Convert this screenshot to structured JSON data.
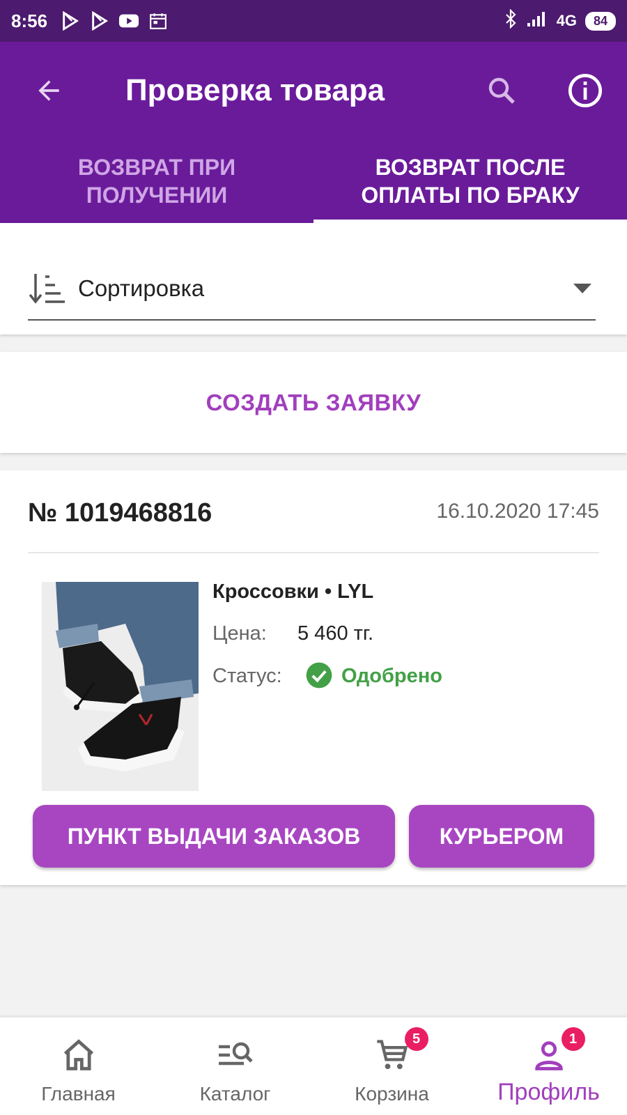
{
  "status_bar": {
    "time": "8:56",
    "network": "4G",
    "battery": "84"
  },
  "app_bar": {
    "title": "Проверка товара"
  },
  "tabs": [
    {
      "label": "Возврат при получении",
      "active": false
    },
    {
      "label": "Возврат после оплаты по браку",
      "active": true
    }
  ],
  "sort": {
    "label": "Сортировка"
  },
  "create_request": {
    "label": "СОЗДАТЬ ЗАЯВКУ"
  },
  "order": {
    "number": "№ 1019468816",
    "date": "16.10.2020 17:45",
    "product_name": "Кроссовки • LYL",
    "price_label": "Цена:",
    "price_value": "5 460 тг.",
    "status_label": "Статус:",
    "status_value": "Одобрено",
    "status_color": "#43a047",
    "buttons": {
      "pickup_point": "ПУНКТ ВЫДАЧИ ЗАКАЗОВ",
      "courier": "КУРЬЕРОМ"
    }
  },
  "bottom_nav": {
    "items": [
      {
        "label": "Главная",
        "icon": "home-icon",
        "badge": null,
        "active": false
      },
      {
        "label": "Каталог",
        "icon": "catalog-search-icon",
        "badge": null,
        "active": false
      },
      {
        "label": "Корзина",
        "icon": "cart-icon",
        "badge": "5",
        "active": false
      },
      {
        "label": "Профиль",
        "icon": "profile-icon",
        "badge": "1",
        "active": true
      }
    ]
  },
  "colors": {
    "primary": "#6a1b9a",
    "status_bar": "#4c1a6e",
    "accent": "#a846c2",
    "badge": "#e91e63"
  }
}
